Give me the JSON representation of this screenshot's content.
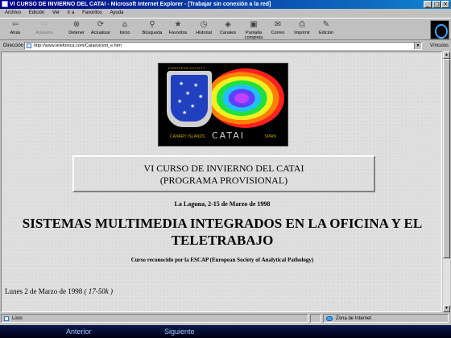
{
  "window": {
    "title": "VI CURSO DE INVIERNO DEL CATAI - Microsoft Internet Explorer - [Trabajar sin conexión a la red]",
    "controls": [
      "_",
      "□",
      "×"
    ]
  },
  "menu": [
    "Archivo",
    "Edición",
    "Ver",
    "Ir a",
    "Favoritos",
    "Ayuda"
  ],
  "toolbar": {
    "buttons": [
      {
        "label": "Atrás",
        "icon": "back-arrow-icon",
        "glyph": "⇦",
        "enabled": true
      },
      {
        "label": "Adelante",
        "icon": "forward-arrow-icon",
        "glyph": "⇨",
        "enabled": false
      },
      {
        "label": "Detener",
        "icon": "stop-icon",
        "glyph": "⊗",
        "enabled": true
      },
      {
        "label": "Actualizar",
        "icon": "refresh-icon",
        "glyph": "⟳",
        "enabled": true
      },
      {
        "label": "Inicio",
        "icon": "home-icon",
        "glyph": "⌂",
        "enabled": true
      },
      {
        "label": "Búsqueda",
        "icon": "search-icon",
        "glyph": "⚲",
        "enabled": true
      },
      {
        "label": "Favoritos",
        "icon": "favorites-icon",
        "glyph": "★",
        "enabled": true
      },
      {
        "label": "Historial",
        "icon": "history-icon",
        "glyph": "◷",
        "enabled": true
      },
      {
        "label": "Canales",
        "icon": "channels-icon",
        "glyph": "◈",
        "enabled": true
      },
      {
        "label": "Pantalla completa",
        "icon": "fullscreen-icon",
        "glyph": "▣",
        "enabled": true
      },
      {
        "label": "Correo",
        "icon": "mail-icon",
        "glyph": "✉",
        "enabled": true
      },
      {
        "label": "Imprimir",
        "icon": "print-icon",
        "glyph": "⎙",
        "enabled": true
      },
      {
        "label": "Edición",
        "icon": "edit-icon",
        "glyph": "✎",
        "enabled": true
      }
    ]
  },
  "address": {
    "label": "Dirección",
    "url": "http://www.telefonica.com/Catai/vicinit_e.htm",
    "links_label": "Vínculos"
  },
  "page": {
    "logo": {
      "top_caption": "EUROPEAN SOCIETY ...",
      "bottom_left": "CANARY ISLANDS",
      "bottom_middle": "CATAI",
      "bottom_right": "SPAIN"
    },
    "title_line1": "VI CURSO DE INVIERNO DEL CATAI",
    "title_line2": "(PROGRAMA PROVISIONAL)",
    "dateline": "La Laguna, 2-15 de Marzo de 1998",
    "heading": "SISTEMAS MULTIMEDIA INTEGRADOS EN LA OFICINA Y EL TELETRABAJO",
    "subnote": "Curso reconocido por la ESCAP (European Society of Analytical Pathology)",
    "day": "Lunes 2 de Marzo de 1998",
    "day_size": "( 17-50k )"
  },
  "status": {
    "text": "Listo",
    "zone": "Zona de Internet"
  },
  "nav": {
    "prev": "Anterior",
    "next": "Siguiente"
  },
  "colors": {
    "titlebar": "#000080",
    "chrome": "#c0c0c0",
    "nav_text": "#9fc3ff"
  }
}
